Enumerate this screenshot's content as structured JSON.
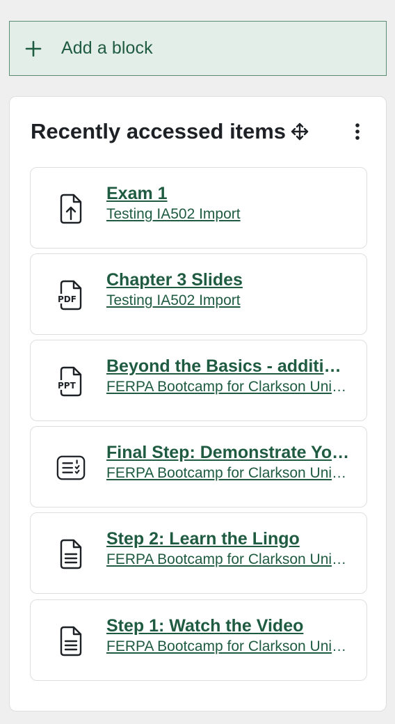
{
  "add_block": {
    "icon": "plus-icon",
    "label": "Add a block"
  },
  "recent_block": {
    "title": "Recently accessed items",
    "move_icon": "move-icon",
    "menu_icon": "kebab-menu-icon",
    "items": [
      {
        "icon": "upload-file-icon",
        "title": "Exam 1",
        "course": "Testing IA502 Import"
      },
      {
        "icon": "pdf-file-icon",
        "title": "Chapter 3 Slides",
        "course": "Testing IA502 Import"
      },
      {
        "icon": "ppt-file-icon",
        "title": "Beyond the Basics - additional resources",
        "course": "FERPA Bootcamp for Clarkson University"
      },
      {
        "icon": "quiz-icon",
        "title": "Final Step: Demonstrate Your Knowledge",
        "course": "FERPA Bootcamp for Clarkson University"
      },
      {
        "icon": "page-icon",
        "title": "Step 2: Learn the Lingo",
        "course": "FERPA Bootcamp for Clarkson University"
      },
      {
        "icon": "page-icon",
        "title": "Step 1: Watch the Video",
        "course": "FERPA Bootcamp for Clarkson University"
      }
    ]
  },
  "colors": {
    "accent": "#1f5b41",
    "add_block_bg": "#e4eee8",
    "page_bg": "#efefef",
    "text_dark": "#1d2125"
  }
}
